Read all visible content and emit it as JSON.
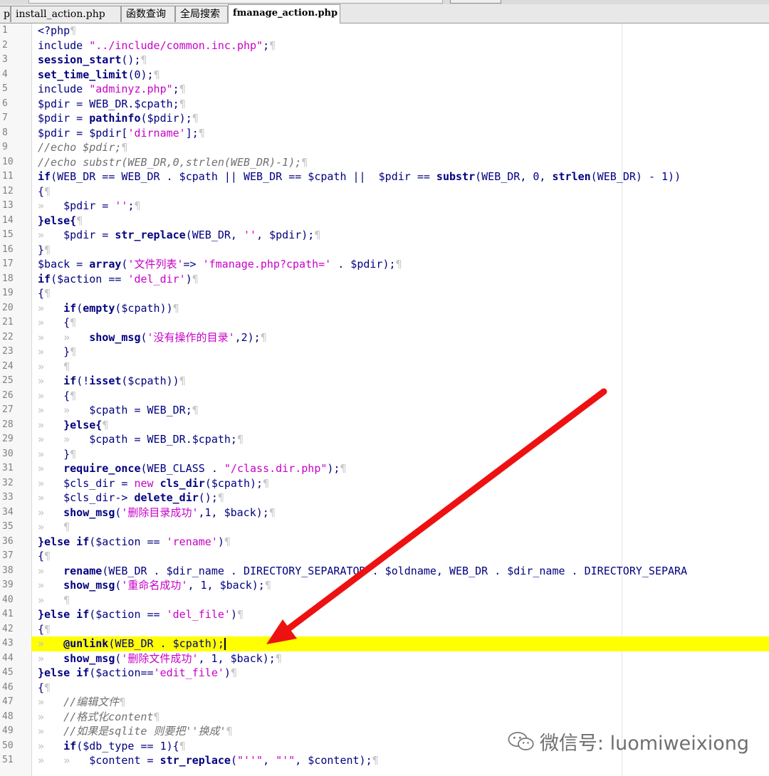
{
  "tabs": [
    {
      "label": "p",
      "active": false
    },
    {
      "label": "install_action.php",
      "active": false
    },
    {
      "label": "函数查询",
      "active": false
    },
    {
      "label": "全局搜索",
      "active": false
    },
    {
      "label": "fmanage_action.php",
      "active": true
    }
  ],
  "highlight_line": 43,
  "cursor_line": 43,
  "colors": {
    "keyword": "#000080",
    "string": "#c800c8",
    "comment": "#707070",
    "highlight": "#ffff00",
    "arrow": "#ee1111",
    "whitespace_marks": "#c8c8c8"
  },
  "watermark": {
    "icon": "wechat-logo-icon",
    "text": "微信号: luomiweixiong"
  },
  "lines": [
    {
      "n": "1",
      "t": 0,
      "s": [
        [
          "<?php",
          "t"
        ]
      ]
    },
    {
      "n": "2",
      "t": 0,
      "s": [
        [
          "include ",
          "t"
        ],
        [
          "\"../include/common.inc.php\"",
          "s"
        ],
        [
          ";",
          "t"
        ]
      ]
    },
    {
      "n": "3",
      "t": 0,
      "s": [
        [
          "session_start",
          "k"
        ],
        [
          "();",
          "t"
        ]
      ]
    },
    {
      "n": "4",
      "t": 0,
      "s": [
        [
          "set_time_limit",
          "k"
        ],
        [
          "(0);",
          "t"
        ]
      ]
    },
    {
      "n": "5",
      "t": 0,
      "s": [
        [
          "include ",
          "t"
        ],
        [
          "\"adminyz.php\"",
          "s"
        ],
        [
          ";",
          "t"
        ]
      ]
    },
    {
      "n": "6",
      "t": 0,
      "s": [
        [
          "$pdir = WEB_DR.$cpath;",
          "t"
        ]
      ]
    },
    {
      "n": "7",
      "t": 0,
      "s": [
        [
          "$pdir = ",
          "t"
        ],
        [
          "pathinfo",
          "k"
        ],
        [
          "($pdir);",
          "t"
        ]
      ]
    },
    {
      "n": "8",
      "t": 0,
      "s": [
        [
          "$pdir = $pdir[",
          "t"
        ],
        [
          "'dirname'",
          "s"
        ],
        [
          "];",
          "t"
        ]
      ]
    },
    {
      "n": "9",
      "t": 0,
      "s": [
        [
          "//echo $pdir;",
          "c"
        ]
      ]
    },
    {
      "n": "10",
      "t": 0,
      "s": [
        [
          "//echo substr(WEB_DR,0,strlen(WEB_DR)-1);",
          "c"
        ]
      ]
    },
    {
      "n": "11",
      "t": 0,
      "s": [
        [
          "if",
          "k"
        ],
        [
          "(WEB_DR == WEB_DR . $cpath || WEB_DR == $cpath ||  $pdir == ",
          "t"
        ],
        [
          "substr",
          "k"
        ],
        [
          "(WEB_DR, 0, ",
          "t"
        ],
        [
          "strlen",
          "k"
        ],
        [
          "(WEB_DR) - 1))",
          "t"
        ]
      ],
      "np": true
    },
    {
      "n": "12",
      "t": 0,
      "s": [
        [
          "{",
          "t"
        ]
      ]
    },
    {
      "n": "13",
      "t": 1,
      "s": [
        [
          "$pdir = ",
          "t"
        ],
        [
          "''",
          "s"
        ],
        [
          ";",
          "t"
        ]
      ]
    },
    {
      "n": "14",
      "t": 0,
      "s": [
        [
          "}else{",
          "k"
        ]
      ]
    },
    {
      "n": "15",
      "t": 1,
      "s": [
        [
          "$pdir = ",
          "t"
        ],
        [
          "str_replace",
          "k"
        ],
        [
          "(WEB_DR, ",
          "t"
        ],
        [
          "''",
          "s"
        ],
        [
          ", $pdir);",
          "t"
        ]
      ]
    },
    {
      "n": "16",
      "t": 0,
      "s": [
        [
          "}",
          "t"
        ]
      ]
    },
    {
      "n": "17",
      "t": 0,
      "s": [
        [
          "$back = ",
          "t"
        ],
        [
          "array",
          "k"
        ],
        [
          "(",
          "t"
        ],
        [
          "'文件列表'",
          "s"
        ],
        [
          "=> ",
          "t"
        ],
        [
          "'fmanage.php?cpath='",
          "s"
        ],
        [
          " . $pdir);",
          "t"
        ]
      ]
    },
    {
      "n": "18",
      "t": 0,
      "s": [
        [
          "if",
          "k"
        ],
        [
          "($action == ",
          "t"
        ],
        [
          "'del_dir'",
          "s"
        ],
        [
          ")",
          "t"
        ]
      ]
    },
    {
      "n": "19",
      "t": 0,
      "s": [
        [
          "{",
          "t"
        ]
      ]
    },
    {
      "n": "20",
      "t": 1,
      "s": [
        [
          "if",
          "k"
        ],
        [
          "(",
          "t"
        ],
        [
          "empty",
          "k"
        ],
        [
          "($cpath))",
          "t"
        ]
      ]
    },
    {
      "n": "21",
      "t": 1,
      "s": [
        [
          "{",
          "t"
        ]
      ]
    },
    {
      "n": "22",
      "t": 2,
      "s": [
        [
          "show_msg",
          "k"
        ],
        [
          "(",
          "t"
        ],
        [
          "'没有操作的目录'",
          "s"
        ],
        [
          ",2);",
          "t"
        ]
      ]
    },
    {
      "n": "23",
      "t": 1,
      "s": [
        [
          "}",
          "t"
        ]
      ]
    },
    {
      "n": "24",
      "t": 1,
      "s": []
    },
    {
      "n": "25",
      "t": 1,
      "s": [
        [
          "if",
          "k"
        ],
        [
          "(!",
          "t"
        ],
        [
          "isset",
          "k"
        ],
        [
          "($cpath))",
          "t"
        ]
      ]
    },
    {
      "n": "26",
      "t": 1,
      "s": [
        [
          "{",
          "t"
        ]
      ]
    },
    {
      "n": "27",
      "t": 2,
      "s": [
        [
          "$cpath = WEB_DR;",
          "t"
        ]
      ]
    },
    {
      "n": "28",
      "t": 1,
      "s": [
        [
          "}else{",
          "k"
        ]
      ]
    },
    {
      "n": "29",
      "t": 2,
      "s": [
        [
          "$cpath = WEB_DR.$cpath;",
          "t"
        ]
      ]
    },
    {
      "n": "30",
      "t": 1,
      "s": [
        [
          "}",
          "t"
        ]
      ]
    },
    {
      "n": "31",
      "t": 1,
      "s": [
        [
          "require_once",
          "k"
        ],
        [
          "(WEB_CLASS . ",
          "t"
        ],
        [
          "\"/class.dir.php\"",
          "s"
        ],
        [
          ");",
          "t"
        ]
      ]
    },
    {
      "n": "32",
      "t": 1,
      "s": [
        [
          "$cls_dir = ",
          "t"
        ],
        [
          "new ",
          "s"
        ],
        [
          "cls_dir",
          "k"
        ],
        [
          "($cpath);",
          "t"
        ]
      ]
    },
    {
      "n": "33",
      "t": 1,
      "s": [
        [
          "$cls_dir-> ",
          "t"
        ],
        [
          "delete_dir",
          "k"
        ],
        [
          "();",
          "t"
        ]
      ]
    },
    {
      "n": "34",
      "t": 1,
      "s": [
        [
          "show_msg",
          "k"
        ],
        [
          "(",
          "t"
        ],
        [
          "'删除目录成功'",
          "s"
        ],
        [
          ",1, $back);",
          "t"
        ]
      ]
    },
    {
      "n": "35",
      "t": 1,
      "s": []
    },
    {
      "n": "36",
      "t": 0,
      "s": [
        [
          "}else if",
          "k"
        ],
        [
          "($action == ",
          "t"
        ],
        [
          "'rename'",
          "s"
        ],
        [
          ")",
          "t"
        ]
      ]
    },
    {
      "n": "37",
      "t": 0,
      "s": [
        [
          "{",
          "t"
        ]
      ]
    },
    {
      "n": "38",
      "t": 1,
      "s": [
        [
          "rename",
          "k"
        ],
        [
          "(WEB_DR . $dir_name . DIRECTORY_SEPARATOR . $oldname, WEB_DR . $dir_name . DIRECTORY_SEPARA",
          "t"
        ]
      ],
      "np": true
    },
    {
      "n": "39",
      "t": 1,
      "s": [
        [
          "show_msg",
          "k"
        ],
        [
          "(",
          "t"
        ],
        [
          "'重命名成功'",
          "s"
        ],
        [
          ", 1, $back);",
          "t"
        ]
      ]
    },
    {
      "n": "40",
      "t": 1,
      "s": []
    },
    {
      "n": "41",
      "t": 0,
      "s": [
        [
          "}else if",
          "k"
        ],
        [
          "($action == ",
          "t"
        ],
        [
          "'del_file'",
          "s"
        ],
        [
          ")",
          "t"
        ]
      ]
    },
    {
      "n": "42",
      "t": 0,
      "s": [
        [
          "{",
          "t"
        ]
      ]
    },
    {
      "n": "43",
      "t": 1,
      "s": [
        [
          "@unlink",
          "k"
        ],
        [
          "(WEB_DR . $cpath);",
          "t"
        ]
      ],
      "np": true
    },
    {
      "n": "44",
      "t": 1,
      "s": [
        [
          "show_msg",
          "k"
        ],
        [
          "(",
          "t"
        ],
        [
          "'删除文件成功'",
          "s"
        ],
        [
          ", 1, $back);",
          "t"
        ]
      ]
    },
    {
      "n": "45",
      "t": 0,
      "s": [
        [
          "}else if",
          "k"
        ],
        [
          "($action==",
          "t"
        ],
        [
          "'edit_file'",
          "s"
        ],
        [
          ")",
          "t"
        ]
      ]
    },
    {
      "n": "46",
      "t": 0,
      "s": [
        [
          "{",
          "t"
        ]
      ]
    },
    {
      "n": "47",
      "t": 1,
      "s": [
        [
          "//编辑文件",
          "c"
        ]
      ]
    },
    {
      "n": "48",
      "t": 1,
      "s": [
        [
          "//格式化content",
          "c"
        ]
      ]
    },
    {
      "n": "49",
      "t": 1,
      "s": [
        [
          "//如果是sqlite 则要把''换成'",
          "c"
        ]
      ]
    },
    {
      "n": "50",
      "t": 1,
      "s": [
        [
          "if",
          "k"
        ],
        [
          "($db_type == 1){",
          "t"
        ]
      ]
    },
    {
      "n": "51",
      "t": 2,
      "s": [
        [
          "$content = ",
          "t"
        ],
        [
          "str_replace",
          "k"
        ],
        [
          "(",
          "t"
        ],
        [
          "\"''\"",
          "s"
        ],
        [
          ", ",
          "t"
        ],
        [
          "\"'\"",
          "s"
        ],
        [
          ", $content);",
          "t"
        ]
      ]
    }
  ]
}
